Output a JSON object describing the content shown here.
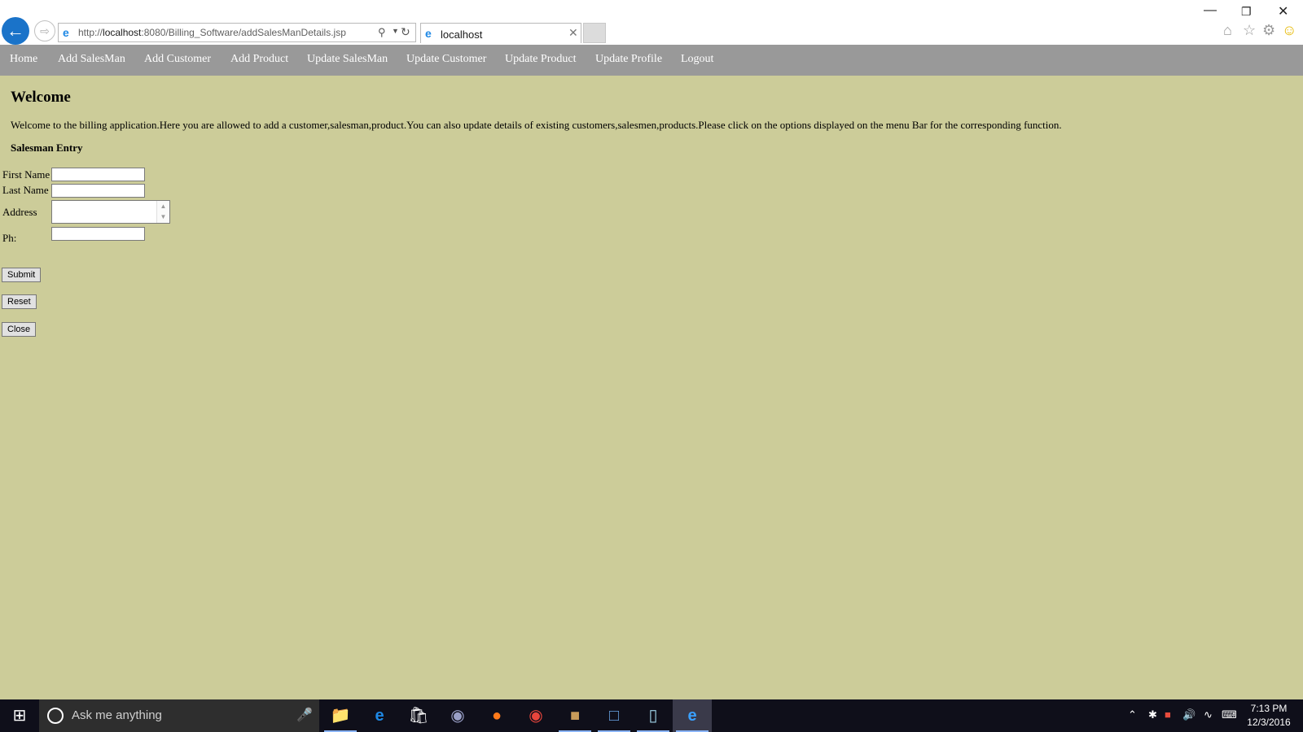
{
  "browser": {
    "url_prefix": "http://",
    "url_host": "localhost",
    "url_rest": ":8080/Billing_Software/addSalesManDetails.jsp",
    "tab_title": "localhost"
  },
  "menu": {
    "items": [
      {
        "label": "Home"
      },
      {
        "label": "Add SalesMan"
      },
      {
        "label": "Add Customer"
      },
      {
        "label": "Add Product"
      },
      {
        "label": "Update SalesMan"
      },
      {
        "label": "Update Customer"
      },
      {
        "label": "Update Product"
      },
      {
        "label": "Update Profile"
      },
      {
        "label": "Logout"
      }
    ]
  },
  "page": {
    "heading": "Welcome",
    "intro": "Welcome to the billing application.Here you are allowed to add a customer,salesman,product.You can also update details of existing customers,salesmen,products.Please click on the options displayed on the menu Bar for the corresponding function.",
    "section_title": "Salesman Entry",
    "form": {
      "first_name_label": "First Name",
      "first_name_value": "",
      "last_name_label": "Last Name",
      "last_name_value": "",
      "address_label": "Address",
      "address_value": "",
      "phone_label": "Ph:",
      "phone_value": "",
      "submit_label": "Submit",
      "reset_label": "Reset",
      "close_label": "Close"
    }
  },
  "taskbar": {
    "search_placeholder": "Ask me anything",
    "time": "7:13 PM",
    "date": "12/3/2016",
    "apps": [
      "file-explorer-icon",
      "edge-icon",
      "store-icon",
      "eclipse-icon",
      "firefox-icon",
      "chrome-icon",
      "game-app-icon",
      "visual-studio-icon",
      "notepad-icon",
      "internet-explorer-icon"
    ]
  },
  "colors": {
    "page_background": "#cccc99",
    "menubar_background": "#999999",
    "menu_text": "#ffffff",
    "taskbar_background": "#0f0f1a"
  }
}
